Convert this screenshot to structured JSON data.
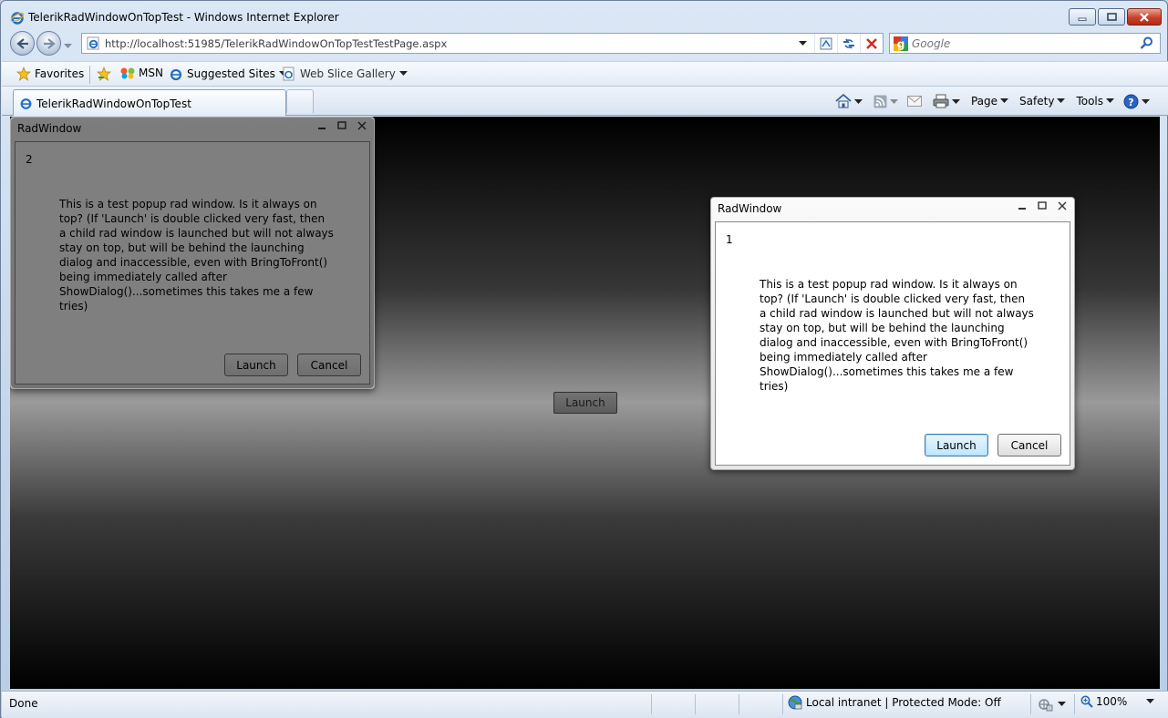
{
  "window": {
    "title": "TelerikRadWindowOnTopTest - Windows Internet Explorer"
  },
  "address": {
    "url": "http://localhost:51985/TelerikRadWindowOnTopTestTestPage.aspx"
  },
  "search": {
    "placeholder": "Google"
  },
  "favorites": {
    "favorites_label": "Favorites",
    "msn_label": "MSN",
    "suggested_label": "Suggested Sites",
    "webslice_label": "Web Slice Gallery"
  },
  "tab": {
    "title": "TelerikRadWindowOnTopTest"
  },
  "commandbar": {
    "page_label": "Page",
    "safety_label": "Safety",
    "tools_label": "Tools"
  },
  "page": {
    "launch_label": "Launch"
  },
  "radwindow_back": {
    "title": "RadWindow",
    "number": "2",
    "message": "This is a test popup rad window. Is it always on top? (If 'Launch' is double clicked very fast, then a child rad window is launched but will not always stay on top, but will be behind the launching dialog and inaccessible, even with BringToFront() being immediately called after ShowDialog()...sometimes this takes me a few tries)",
    "launch_label": "Launch",
    "cancel_label": "Cancel"
  },
  "radwindow_front": {
    "title": "RadWindow",
    "number": "1",
    "message": "This is a test popup rad window. Is it always on top? (If 'Launch' is double clicked very fast, then a child rad window is launched but will not always stay on top, but will be behind the launching dialog and inaccessible, even with BringToFront() being immediately called after ShowDialog()...sometimes this takes me a few tries)",
    "launch_label": "Launch",
    "cancel_label": "Cancel"
  },
  "status": {
    "text": "Done",
    "zone": "Local intranet | Protected Mode: Off",
    "zoom": "100%"
  },
  "colors": {
    "ie_blue": "#1f6fc5",
    "close_red": "#c8412c"
  }
}
